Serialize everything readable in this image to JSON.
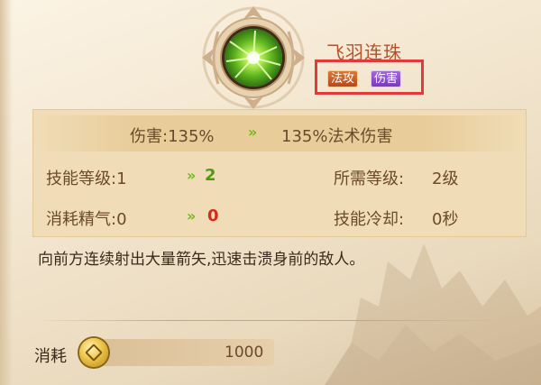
{
  "skill": {
    "name": "飞羽连珠",
    "icon": "green-burst-skill-icon",
    "tags": [
      "法攻",
      "伤害"
    ]
  },
  "stats": {
    "damage": {
      "current": "伤害:135%",
      "next": "135%法术伤害"
    },
    "skill_level": {
      "label": "技能等级:1",
      "next": "2"
    },
    "required_level": {
      "label": "所需等级:",
      "value": "2级"
    },
    "energy_cost": {
      "label": "消耗精气:0",
      "next": "0"
    },
    "cooldown": {
      "label": "技能冷却:",
      "value": "0秒"
    },
    "arrow": "»"
  },
  "description": "向前方连续射出大量箭矢,迅速击溃身前的敌人。",
  "cost": {
    "label": "消耗",
    "value": "1000",
    "icon": "gold-coin-icon"
  },
  "colors": {
    "accent_red": "#e23a3a",
    "upgrade_green": "#4f9a10",
    "value_red": "#d22b1c"
  }
}
